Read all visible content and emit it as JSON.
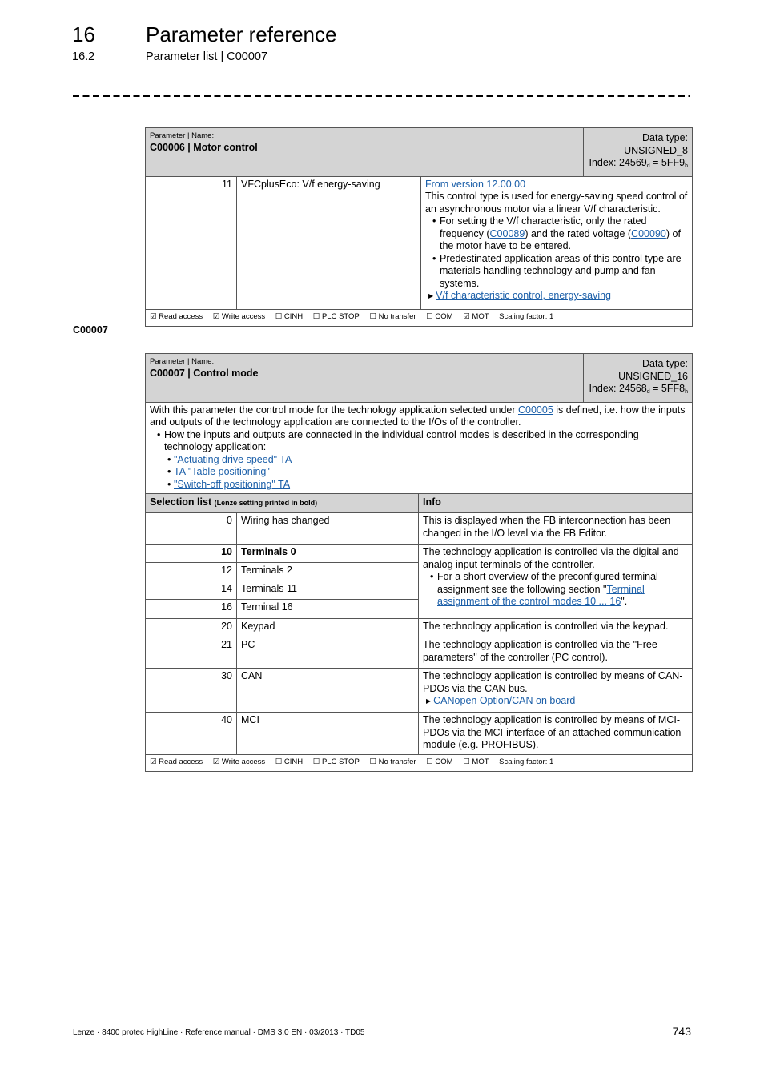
{
  "header": {
    "chapter_number": "16",
    "chapter_title": "Parameter reference",
    "section_number": "16.2",
    "section_title": "Parameter list | C00007"
  },
  "table_c00006": {
    "label": "Parameter | Name:",
    "name": "C00006 | Motor control",
    "data_type": "Data type: UNSIGNED_8",
    "index_prefix": "Index: 24569",
    "index_sub_d": "d",
    "index_mid": " = 5FF9",
    "index_sub_h": "h",
    "row": {
      "value": "11",
      "name": "VFCplusEco: V/f energy-saving",
      "version": "From version 12.00.00",
      "desc": "This control type is used for energy-saving speed control of an asynchronous motor via a linear V/f characteristic.",
      "bullet1_a": "For setting the V/f characteristic, only the rated frequency (",
      "bullet1_link1": "C00089",
      "bullet1_b": ") and the rated voltage (",
      "bullet1_link2": "C00090",
      "bullet1_c": ") of the motor have to be entered.",
      "bullet2": "Predestinated application areas of this control type are materials handling technology and pump and fan systems.",
      "link": "V/f characteristic control, energy-saving"
    },
    "flags": [
      {
        "label": "Read access",
        "checked": "☑"
      },
      {
        "label": "Write access",
        "checked": "☑"
      },
      {
        "label": "CINH",
        "checked": "☐"
      },
      {
        "label": "PLC STOP",
        "checked": "☐"
      },
      {
        "label": "No transfer",
        "checked": "☐"
      },
      {
        "label": "COM",
        "checked": "☐"
      },
      {
        "label": "MOT",
        "checked": "☑"
      }
    ],
    "scaling": "Scaling factor: 1"
  },
  "section_label": "C00007",
  "table_c00007": {
    "label": "Parameter | Name:",
    "name": "C00007 | Control mode",
    "data_type": "Data type: UNSIGNED_16",
    "index_prefix": "Index: 24568",
    "index_sub_d": "d",
    "index_mid": " = 5FF8",
    "index_sub_h": "h",
    "intro_a": "With this parameter the control mode for the technology application selected under ",
    "intro_link": "C00005",
    "intro_b": " is defined, i.e. how the inputs and outputs of the technology application are connected to the I/Os of the controller.",
    "intro_bullet": "How the inputs and outputs are connected in the individual control modes is described in the corresponding technology application:",
    "ta_links": [
      "\"Actuating drive speed\" TA",
      "TA \"Table positioning\"",
      "\"Switch-off positioning\" TA"
    ],
    "selection_header": "Selection list",
    "selection_header_note": "(Lenze setting printed in bold)",
    "info_header": "Info",
    "rows": [
      {
        "value": "0",
        "name": "Wiring has changed",
        "info": "This is displayed when the FB interconnection has been changed in the I/O level via the FB Editor."
      },
      {
        "value": "10",
        "name": "Terminals 0"
      },
      {
        "value": "12",
        "name": "Terminals 2"
      },
      {
        "value": "14",
        "name": "Terminals 11"
      },
      {
        "value": "16",
        "name": "Terminal 16"
      },
      {
        "value": "20",
        "name": "Keypad",
        "info": "The technology application is controlled via the keypad."
      },
      {
        "value": "21",
        "name": "PC",
        "info": "The technology application is controlled via the \"Free parameters\" of the controller (PC control)."
      },
      {
        "value": "30",
        "name": "CAN",
        "info": "The technology application is controlled by means of CAN-PDOs via the CAN bus.",
        "link": "CANopen Option/CAN on board"
      },
      {
        "value": "40",
        "name": "MCI",
        "info": "The technology application is controlled by means of MCI-PDOs via the MCI-interface of an attached communication module (e.g. PROFIBUS)."
      }
    ],
    "terminals_info": "The technology application is controlled via the digital and analog input terminals of the controller.",
    "terminals_bullet_a": "For a short overview of the preconfigured terminal assignment see the following section \"",
    "terminals_bullet_link": "Terminal assignment of the control modes 10 ... 16",
    "terminals_bullet_b": "\".",
    "flags": [
      {
        "label": "Read access",
        "checked": "☑"
      },
      {
        "label": "Write access",
        "checked": "☑"
      },
      {
        "label": "CINH",
        "checked": "☐"
      },
      {
        "label": "PLC STOP",
        "checked": "☐"
      },
      {
        "label": "No transfer",
        "checked": "☐"
      },
      {
        "label": "COM",
        "checked": "☐"
      },
      {
        "label": "MOT",
        "checked": "☐"
      }
    ],
    "scaling": "Scaling factor: 1"
  },
  "footer": {
    "text": "Lenze · 8400 protec HighLine · Reference manual · DMS 3.0 EN · 03/2013 · TD05",
    "page": "743"
  }
}
